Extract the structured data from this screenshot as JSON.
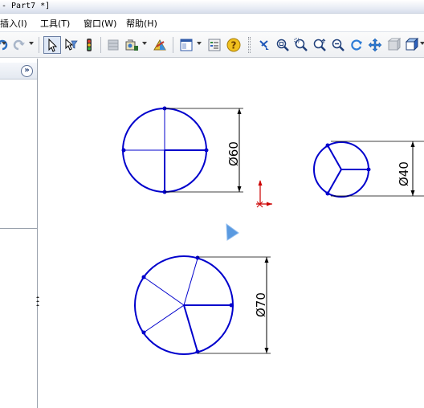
{
  "window": {
    "title": "- Part7 *]"
  },
  "menu": {
    "items": [
      "插入(I)",
      "工具(T)",
      "窗口(W)",
      "帮助(H)"
    ]
  },
  "toolbar": {
    "icons": [
      "undo-icon",
      "redo-icon",
      "select-arrow-icon",
      "select-filter-icon",
      "traffic-light-icon",
      "sheet-icon",
      "view-icon",
      "appearance-icon",
      "display-style-icon",
      "properties-icon",
      "help-icon",
      "rotate-view-icon",
      "zoom-to-fit-icon",
      "zoom-area-icon",
      "zoom-in-out-icon",
      "zoom-selection-icon",
      "redraw-icon",
      "pan-icon",
      "view-orientation-icon"
    ]
  },
  "left_panel": {
    "expand_label": "»"
  },
  "drawing": {
    "dimensions": {
      "circle_60": "Ø60",
      "circle_40": "Ø40",
      "circle_70": "Ø70"
    },
    "colors": {
      "sketch": "#0000cc",
      "dimension": "#000000",
      "origin": "#cc0000",
      "cursor": "#4f8fd6"
    }
  }
}
